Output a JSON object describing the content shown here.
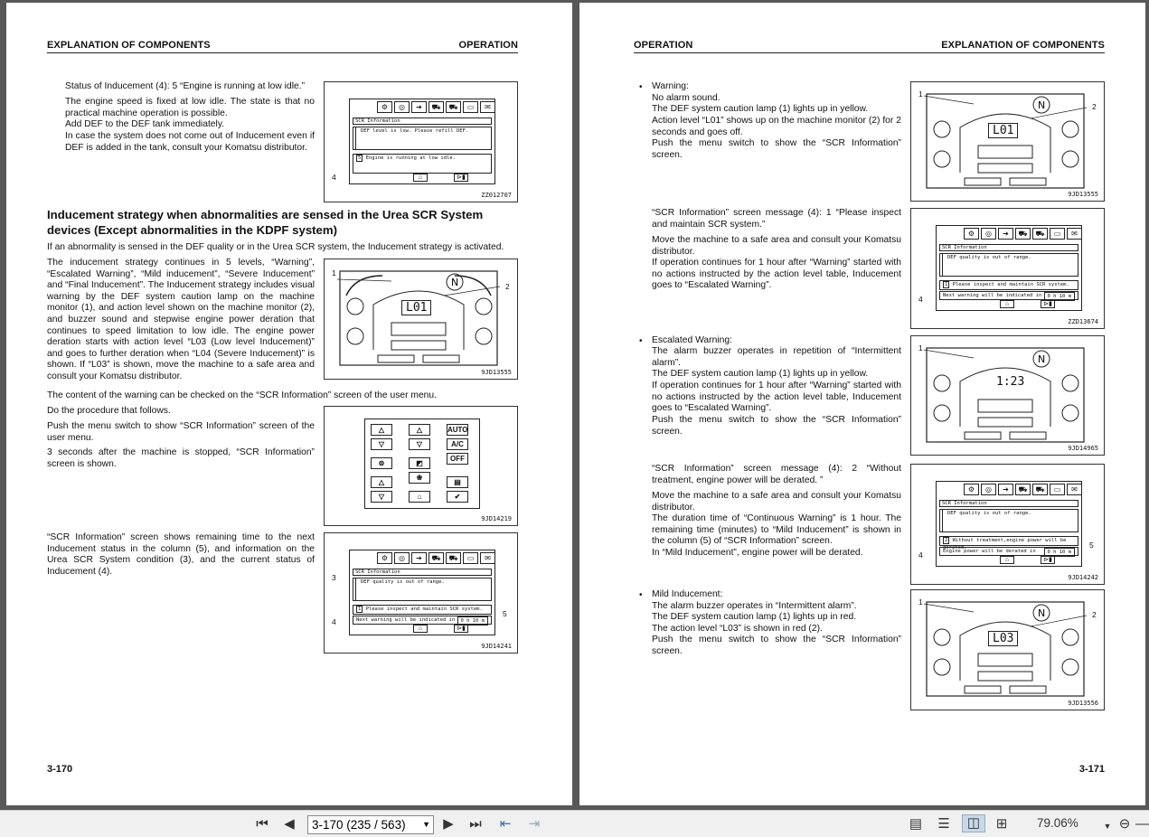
{
  "left_page": {
    "header_left": "EXPLANATION OF COMPONENTS",
    "header_right": "OPERATION",
    "page_number": "3-170",
    "para1": "Status of Inducement (4): 5 “Engine is running at low idle.”",
    "para2": "The engine speed is fixed at low idle. The state is that no practical machine operation is possible.",
    "para3": "Add DEF to the DEF tank immediately.",
    "para4": "In case the system does not come out of Inducement even if DEF is added in the tank, consult your Komatsu distributor.",
    "heading": "Inducement strategy when abnormalities are sensed in the Urea SCR System devices (Except abnormalities in the KDPF system)",
    "para5": "If an abnormality is sensed in the DEF quality or in the Urea SCR system, the Inducement strategy is activated.",
    "para6": "The inducement strategy continues in 5 levels, “Warning”, “Escalated Warning”, “Mild inducement”, “Severe Inducement” and “Final Inducement”. The Inducement strategy includes visual warning by the DEF system caution lamp on the machine monitor (1), and action level shown on the machine monitor (2), and buzzer sound and stepwise engine power deration that continues to speed limitation to low idle. The engine power deration starts with action level “L03 (Low level Inducement)” and goes to further deration when “L04 (Severe Inducement)” is shown. If “L03” is shown, move the machine to a safe area and consult your Komatsu distributor.",
    "para7": "The content of the warning can be checked on the “SCR Information” screen of the user menu.",
    "para8": "Do the procedure that follows.",
    "para9": "Push the menu switch to show “SCR Information” screen of the user menu.",
    "para10": "3 seconds after the machine is stopped, “SCR Information” screen is shown.",
    "para11": "“SCR Information” screen shows remaining time to the next Inducement status in the column (5), and information on the Urea SCR System condition (3), and the current status of Inducement (4).",
    "fig1": {
      "code": "ZZ012707",
      "title": "SCR Information",
      "msg": "DEF level is low. Please refill DEF.",
      "status_num": "5",
      "status": "Engine is running at low idle.",
      "label": "4"
    },
    "fig2": {
      "code": "9JD13555",
      "level": "L01",
      "label1": "1",
      "label2": "2"
    },
    "fig3": {
      "code": "9JD14219",
      "keys": [
        "AUTO",
        "A/C",
        "OFF"
      ]
    },
    "fig4": {
      "code": "9JD14241",
      "title": "SCR Information",
      "msg": "DEF quality is out of range.",
      "status_num": "1",
      "status": "Please inspect and maintain SCR system.",
      "next": "Next warning will be indicated in",
      "time": "0 h 10 m",
      "label3": "3",
      "label4": "4",
      "label5": "5"
    }
  },
  "right_page": {
    "header_left": "OPERATION",
    "header_right": "EXPLANATION OF COMPONENTS",
    "page_number": "3-171",
    "warning": {
      "title": "Warning:",
      "l1": "No alarm sound.",
      "l2": "The DEF system caution lamp (1) lights up in yellow.",
      "l3": "Action level “L01” shows up on the machine monitor (2) for 2 seconds and goes off.",
      "l4": "Push the menu switch to show the “SCR Information” screen."
    },
    "msg1": "“SCR Information” screen message (4): 1 “Please inspect and maintain SCR system.”",
    "msg1b": "Move the machine to a safe area and consult your Komatsu distributor.",
    "msg1c": "If operation continues for 1 hour after “Warning” started with no actions instructed by the action level table, Inducement goes to “Escalated Warning”.",
    "escalated": {
      "title": "Escalated Warning:",
      "l1": "The alarm buzzer operates in repetition of “Intermittent alarm”.",
      "l2": "The DEF system caution lamp (1) lights up in yellow.",
      "l3": "If operation continues for 1 hour after “Warning” started with no actions instructed by the action level table, Inducement goes to “Escalated Warning”.",
      "l4": "Push the menu switch to show the “SCR Information” screen."
    },
    "msg2": "“SCR Information” screen message (4): 2 “Without treatment, engine power will be derated. ”",
    "msg2b": "Move the machine to a safe area and consult your Komatsu distributor.",
    "msg2c": "The duration time of “Continuous Warning” is 1 hour. The remaining time (minutes) to “Mild Inducement” is shown in the column (5) of “SCR Information” screen.",
    "msg2d": "In “Mild Inducement”, engine power will be derated.",
    "mild": {
      "title": "Mild Inducement:",
      "l1": "The alarm buzzer operates in “Intermittent alarm”.",
      "l2": "The DEF system caution lamp (1) lights up in red.",
      "l3": "The action level “L03” is shown in red (2).",
      "l4": "Push the menu switch to show the “SCR Information” screen."
    },
    "rfig1": {
      "code": "9JD13555",
      "level": "L01",
      "label1": "1",
      "label2": "2"
    },
    "rfig2": {
      "code": "ZZD13674",
      "title": "SCR Information",
      "msg": "DEF quality is out of range.",
      "status_num": "1",
      "status": "Please inspect and maintain SCR system.",
      "next": "Next warning will be indicated in",
      "time": "0 h 10 m",
      "label": "4"
    },
    "rfig3": {
      "code": "9JD14965",
      "level": "1:23",
      "label1": "1"
    },
    "rfig4": {
      "code": "9JD14242",
      "title": "SCR Information",
      "msg": "DEF quality is out of range.",
      "status_num": "2",
      "status": "Without treatment,engine power will be derated.",
      "next": "Engine power will be derated in",
      "time": "0 h 10 m",
      "label4": "4",
      "label5": "5"
    },
    "rfig5": {
      "code": "9JD13556",
      "level": "L03",
      "label1": "1",
      "label2": "2"
    }
  },
  "toolbar": {
    "page_field": "3-170 (235 / 563)",
    "zoom": "79.06%",
    "icons": [
      "first-page-icon",
      "prev-page-icon",
      "next-page-icon",
      "last-page-icon",
      "prev-view-icon",
      "next-view-icon",
      "single-page-icon",
      "continuous-icon",
      "facing-icon",
      "continuous-facing-icon",
      "zoom-out-icon"
    ]
  }
}
